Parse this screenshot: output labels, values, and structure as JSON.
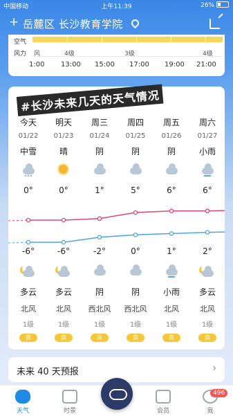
{
  "status": {
    "carrier": "中国移动",
    "time": "上午11:39",
    "battery": "26%"
  },
  "header": {
    "plus": "+",
    "location": "岳麓区 长沙教育学院"
  },
  "hourly": {
    "air_label": "空气",
    "wind_label": "风力",
    "wind_values": [
      "风",
      "4级",
      "3级",
      "4级"
    ],
    "hours": [
      "1:00",
      "13:00",
      "15:00",
      "17:00",
      "19:00",
      "21:00"
    ]
  },
  "overlay_text": "#长沙未来几天的天气情况",
  "days": [
    {
      "name": "今天",
      "date": "01/22",
      "day_wx": "中雪",
      "day_icon": "snow-cloud-icon",
      "high": "0°",
      "low": "-6°",
      "night_icon": "moon-cloud-icon",
      "night_wx": "多云",
      "wind": "北风",
      "level": "1级",
      "aqi": "良"
    },
    {
      "name": "明天",
      "date": "01/23",
      "day_wx": "晴",
      "day_icon": "sun-icon",
      "high": "0°",
      "low": "-6°",
      "night_icon": "moon-cloud-icon",
      "night_wx": "多云",
      "wind": "北风",
      "level": "1级",
      "aqi": "良"
    },
    {
      "name": "周三",
      "date": "01/24",
      "day_wx": "阴",
      "day_icon": "cloud-icon",
      "high": "1°",
      "low": "-2°",
      "night_icon": "cloud-icon",
      "night_wx": "阴",
      "wind": "西北风",
      "level": "1级",
      "aqi": "良"
    },
    {
      "name": "周四",
      "date": "01/25",
      "day_wx": "阴",
      "day_icon": "cloud-icon",
      "high": "5°",
      "low": "0°",
      "night_icon": "cloud-icon",
      "night_wx": "阴",
      "wind": "西北风",
      "level": "1级",
      "aqi": "良"
    },
    {
      "name": "周五",
      "date": "01/26",
      "day_wx": "阴",
      "day_icon": "cloud-icon",
      "high": "6°",
      "low": "1°",
      "night_icon": "rain-cloud-icon",
      "night_wx": "小雨",
      "wind": "北风",
      "level": "1级",
      "aqi": "良"
    },
    {
      "name": "周六",
      "date": "01/27",
      "day_wx": "小雨",
      "day_icon": "rain-cloud-icon",
      "high": "6°",
      "low": "2°",
      "night_icon": "moon-cloud-icon",
      "night_wx": "多云",
      "wind": "北风",
      "level": "1级",
      "aqi": "良"
    }
  ],
  "forecast_40": "未来 40 天预报",
  "tabs": [
    {
      "label": "天气",
      "icon": "weather-icon",
      "active": true
    },
    {
      "label": "时景",
      "icon": "photo-icon",
      "active": false
    },
    {
      "label": "会员",
      "icon": "member-icon",
      "active": false
    },
    {
      "label": "我",
      "icon": "profile-icon",
      "active": false
    }
  ],
  "badge": "496",
  "colors": {
    "high_line": "#d9467c",
    "low_line": "#49a4e6",
    "aqi_good": "#f5c73a",
    "accent": "#1e8ae6"
  }
}
